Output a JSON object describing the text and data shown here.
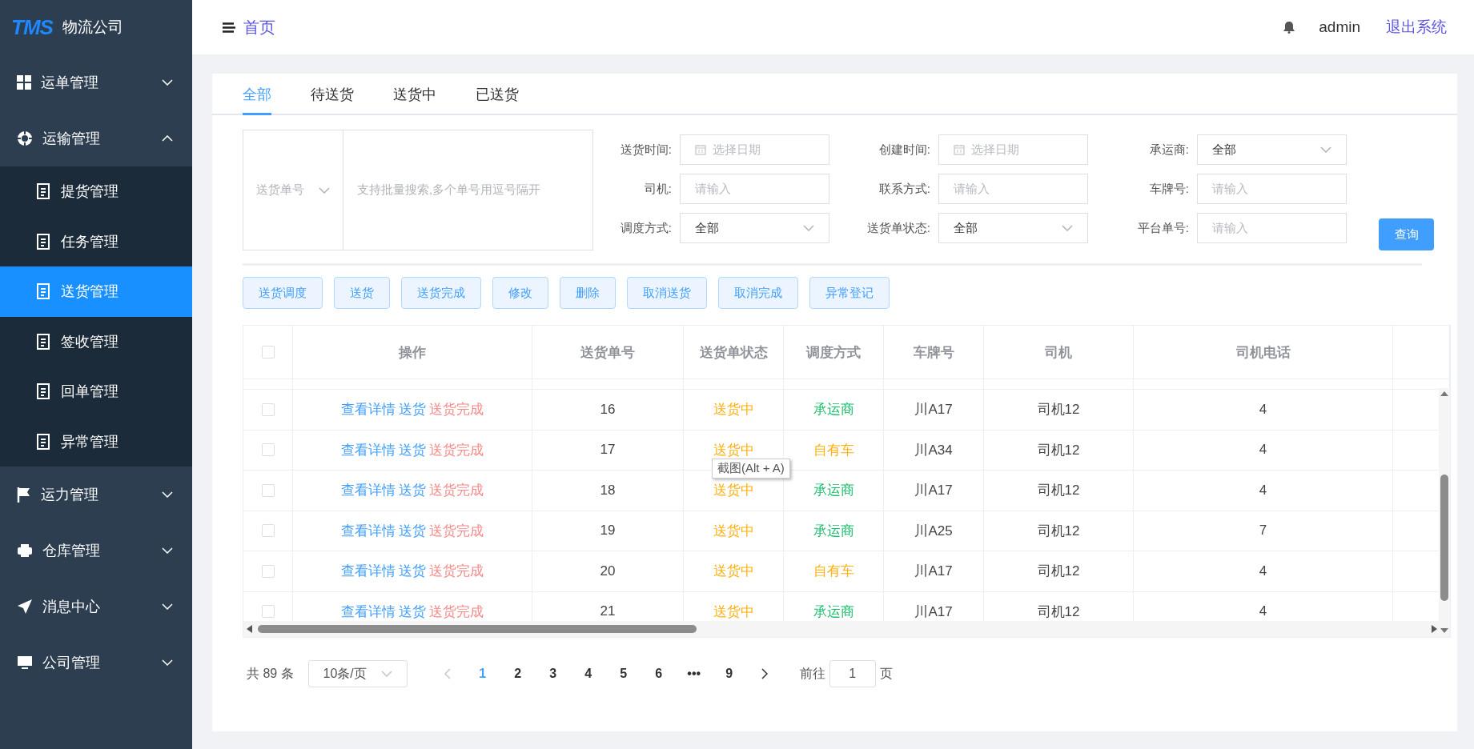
{
  "sidebar": {
    "logo": "TMS",
    "company": "物流公司",
    "items": [
      {
        "label": "运单管理",
        "expanded": false
      },
      {
        "label": "运输管理",
        "expanded": true,
        "children": [
          {
            "label": "提货管理",
            "selected": false
          },
          {
            "label": "任务管理",
            "selected": false
          },
          {
            "label": "送货管理",
            "selected": true
          },
          {
            "label": "签收管理",
            "selected": false
          },
          {
            "label": "回单管理",
            "selected": false
          },
          {
            "label": "异常管理",
            "selected": false
          }
        ]
      },
      {
        "label": "运力管理",
        "expanded": false
      },
      {
        "label": "仓库管理",
        "expanded": false
      },
      {
        "label": "消息中心",
        "expanded": false
      },
      {
        "label": "公司管理",
        "expanded": false
      }
    ]
  },
  "header": {
    "breadcrumb": "首页",
    "user": "admin",
    "logout": "退出系统"
  },
  "tabs": [
    {
      "label": "全部",
      "selected": true
    },
    {
      "label": "待送货",
      "selected": false
    },
    {
      "label": "送货中",
      "selected": false
    },
    {
      "label": "已送货",
      "selected": false
    }
  ],
  "search": {
    "type_select": "送货单号",
    "placeholder": "支持批量搜索,多个单号用逗号隔开"
  },
  "filters": [
    {
      "label": "送货时间:",
      "kind": "date",
      "placeholder": "选择日期"
    },
    {
      "label": "创建时间:",
      "kind": "date",
      "placeholder": "选择日期"
    },
    {
      "label": "承运商:",
      "kind": "select",
      "value": "全部"
    },
    {
      "label": "司机:",
      "kind": "input",
      "placeholder": "请输入"
    },
    {
      "label": "联系方式:",
      "kind": "input",
      "placeholder": "请输入"
    },
    {
      "label": "车牌号:",
      "kind": "input",
      "placeholder": "请输入"
    },
    {
      "label": "调度方式:",
      "kind": "select",
      "value": "全部"
    },
    {
      "label": "送货单状态:",
      "kind": "select",
      "value": "全部"
    },
    {
      "label": "平台单号:",
      "kind": "input",
      "placeholder": "请输入"
    }
  ],
  "query_button": "查询",
  "actions": [
    "送货调度",
    "送货",
    "送货完成",
    "修改",
    "删除",
    "取消送货",
    "取消完成",
    "异常登记"
  ],
  "table": {
    "header_checked": false,
    "columns": [
      "操作",
      "送货单号",
      "送货单状态",
      "调度方式",
      "车牌号",
      "司机",
      "司机电话"
    ],
    "rows": [
      {
        "checked": false,
        "links": [
          {
            "text": "查看详情",
            "color": "#409eff"
          },
          {
            "text": "送货",
            "color": "#409eff"
          },
          {
            "text": "送货完成",
            "color": "#f78989"
          }
        ],
        "number": "16",
        "status": {
          "text": "送货中",
          "color": "#ffb00f"
        },
        "dispatch": {
          "text": "承运商",
          "color": "#19be6b"
        },
        "plate": "川A17",
        "driver": "司机12",
        "phone": "4"
      },
      {
        "checked": false,
        "links": [
          {
            "text": "查看详情",
            "color": "#409eff"
          },
          {
            "text": "送货",
            "color": "#409eff"
          },
          {
            "text": "送货完成",
            "color": "#f78989"
          }
        ],
        "number": "17",
        "status": {
          "text": "送货中",
          "color": "#ffb00f"
        },
        "dispatch": {
          "text": "自有车",
          "color": "#ffb00f"
        },
        "plate": "川A34",
        "driver": "司机12",
        "phone": "4"
      },
      {
        "checked": false,
        "links": [
          {
            "text": "查看详情",
            "color": "#409eff"
          },
          {
            "text": "送货",
            "color": "#409eff"
          },
          {
            "text": "送货完成",
            "color": "#f78989"
          }
        ],
        "number": "18",
        "status": {
          "text": "送货中",
          "color": "#ffb00f"
        },
        "dispatch": {
          "text": "承运商",
          "color": "#19be6b"
        },
        "plate": "川A17",
        "driver": "司机12",
        "phone": "4"
      },
      {
        "checked": false,
        "links": [
          {
            "text": "查看详情",
            "color": "#409eff"
          },
          {
            "text": "送货",
            "color": "#409eff"
          },
          {
            "text": "送货完成",
            "color": "#f78989"
          }
        ],
        "number": "19",
        "status": {
          "text": "送货中",
          "color": "#ffb00f"
        },
        "dispatch": {
          "text": "承运商",
          "color": "#19be6b"
        },
        "plate": "川A25",
        "driver": "司机12",
        "phone": "7"
      },
      {
        "checked": false,
        "links": [
          {
            "text": "查看详情",
            "color": "#409eff"
          },
          {
            "text": "送货",
            "color": "#409eff"
          },
          {
            "text": "送货完成",
            "color": "#f78989"
          }
        ],
        "number": "20",
        "status": {
          "text": "送货中",
          "color": "#ffb00f"
        },
        "dispatch": {
          "text": "自有车",
          "color": "#ffb00f"
        },
        "plate": "川A17",
        "driver": "司机12",
        "phone": "4"
      },
      {
        "checked": false,
        "links": [
          {
            "text": "查看详情",
            "color": "#409eff"
          },
          {
            "text": "送货",
            "color": "#409eff"
          },
          {
            "text": "送货完成",
            "color": "#f78989"
          }
        ],
        "number": "21",
        "status": {
          "text": "送货中",
          "color": "#ffb00f"
        },
        "dispatch": {
          "text": "承运商",
          "color": "#19be6b"
        },
        "plate": "川A17",
        "driver": "司机12",
        "phone": "4"
      }
    ]
  },
  "tooltip": "截图(Alt + A)",
  "pagination": {
    "total": "共 89 条",
    "page_size": "10条/页",
    "pages": [
      {
        "label": "1",
        "selected": true
      },
      {
        "label": "2",
        "selected": false
      },
      {
        "label": "3",
        "selected": false
      },
      {
        "label": "4",
        "selected": false
      },
      {
        "label": "5",
        "selected": false
      },
      {
        "label": "6",
        "selected": false
      },
      {
        "label": "•••",
        "selected": false
      },
      {
        "label": "9",
        "selected": false
      }
    ],
    "goto": "前往",
    "goto_value": "1",
    "page_unit": "页"
  }
}
